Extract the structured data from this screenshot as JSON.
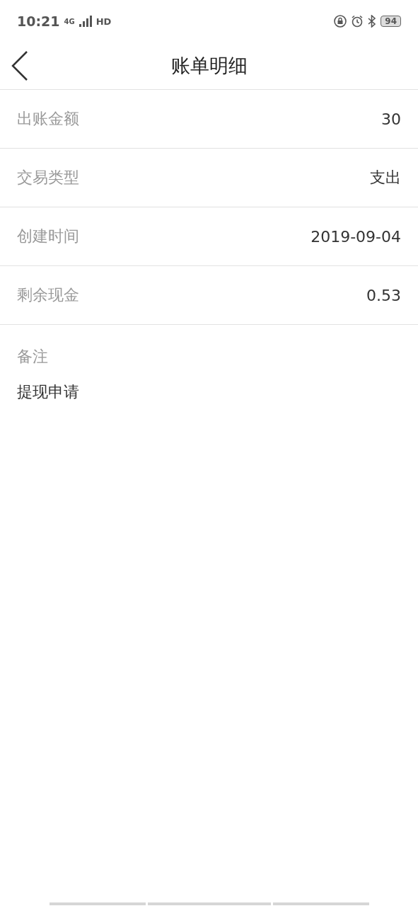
{
  "status_bar": {
    "time": "10:21",
    "network": "4G",
    "hd": "HD",
    "battery": "94"
  },
  "header": {
    "title": "账单明细"
  },
  "rows": [
    {
      "label": "出账金额",
      "value": "30"
    },
    {
      "label": "交易类型",
      "value": "支出"
    },
    {
      "label": "创建时间",
      "value": "2019-09-04"
    },
    {
      "label": "剩余现金",
      "value": "0.53"
    }
  ],
  "remark": {
    "label": "备注",
    "text": "提现申请"
  }
}
